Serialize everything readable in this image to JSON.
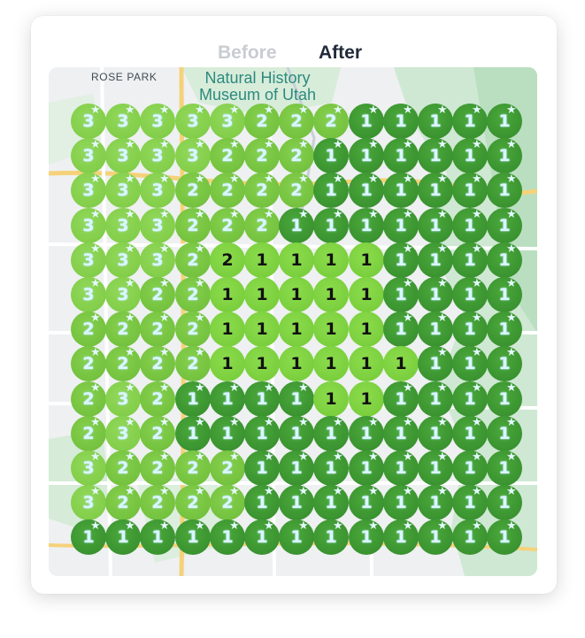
{
  "tabs": [
    {
      "label": "Before",
      "active": false
    },
    {
      "label": "After",
      "active": true
    }
  ],
  "map": {
    "labels": {
      "rose_park": "ROSE PARK",
      "museum_line1": "Natural History",
      "museum_line2": "Museum of Utah"
    },
    "grid_size": 13,
    "ranks": [
      [
        3,
        3,
        3,
        3,
        3,
        2,
        2,
        2,
        1,
        1,
        1,
        1,
        1
      ],
      [
        3,
        3,
        3,
        3,
        2,
        2,
        2,
        1,
        1,
        1,
        1,
        1,
        1
      ],
      [
        3,
        3,
        3,
        2,
        2,
        2,
        2,
        1,
        1,
        1,
        1,
        1,
        1
      ],
      [
        3,
        3,
        3,
        2,
        2,
        2,
        1,
        1,
        1,
        1,
        1,
        1,
        1
      ],
      [
        3,
        3,
        3,
        2,
        2,
        1,
        1,
        1,
        1,
        1,
        1,
        1,
        1
      ],
      [
        3,
        3,
        2,
        2,
        1,
        1,
        1,
        1,
        1,
        1,
        1,
        1,
        1
      ],
      [
        2,
        2,
        2,
        2,
        1,
        1,
        1,
        1,
        1,
        1,
        1,
        1,
        1
      ],
      [
        2,
        2,
        2,
        2,
        1,
        1,
        1,
        1,
        1,
        1,
        1,
        1,
        1
      ],
      [
        2,
        3,
        2,
        1,
        1,
        1,
        1,
        1,
        1,
        1,
        1,
        1,
        1
      ],
      [
        2,
        3,
        2,
        1,
        1,
        1,
        1,
        1,
        1,
        1,
        1,
        1,
        1
      ],
      [
        3,
        2,
        2,
        2,
        2,
        1,
        1,
        1,
        1,
        1,
        1,
        1,
        1
      ],
      [
        3,
        2,
        2,
        2,
        2,
        1,
        1,
        1,
        1,
        1,
        1,
        1,
        1
      ],
      [
        1,
        1,
        1,
        1,
        1,
        1,
        1,
        1,
        1,
        1,
        1,
        1,
        1
      ]
    ],
    "plain_cells": [
      [
        4,
        4
      ],
      [
        4,
        5
      ],
      [
        4,
        6
      ],
      [
        4,
        7
      ],
      [
        4,
        8
      ],
      [
        5,
        4
      ],
      [
        5,
        5
      ],
      [
        5,
        6
      ],
      [
        5,
        7
      ],
      [
        5,
        8
      ],
      [
        6,
        4
      ],
      [
        6,
        5
      ],
      [
        6,
        6
      ],
      [
        6,
        7
      ],
      [
        6,
        8
      ],
      [
        7,
        4
      ],
      [
        7,
        5
      ],
      [
        7,
        6
      ],
      [
        7,
        7
      ],
      [
        7,
        8
      ],
      [
        7,
        9
      ],
      [
        8,
        7
      ],
      [
        8,
        8
      ]
    ],
    "star_icon": "star-icon",
    "colors": {
      "rank_1": "#3a9330",
      "rank_2": "#74c23f",
      "rank_3": "#82ce4a",
      "plain": "#79ce3c",
      "number_light": "#dbf6ff",
      "number_dark": "#111111"
    }
  }
}
